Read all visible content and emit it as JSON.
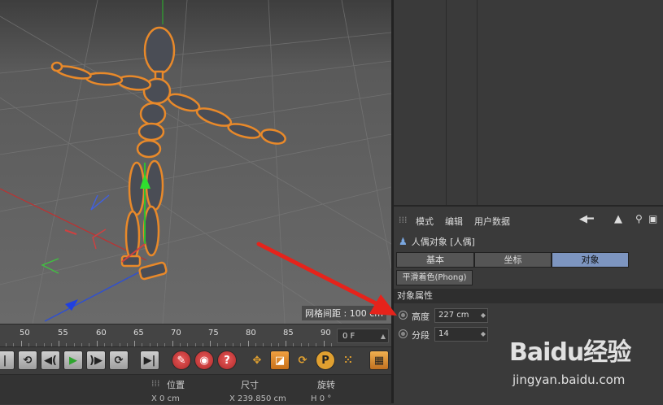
{
  "viewport": {
    "grid_spacing_label": "网格间距 : 100 cm"
  },
  "timeline": {
    "ticks": [
      "50",
      "55",
      "60",
      "65",
      "70",
      "75",
      "80",
      "85",
      "90"
    ],
    "current_frame": "0 F"
  },
  "transport": {
    "buttons": [
      "go-start",
      "prev-key",
      "play-back",
      "play-forward",
      "next-key",
      "go-end",
      "goto-frame",
      "record",
      "autokey",
      "keyframe-help",
      "move-key",
      "scale-key",
      "rotate-key",
      "param-key",
      "point-level",
      "film-strip"
    ]
  },
  "coord_strip": {
    "position_label": "位置",
    "size_label": "尺寸",
    "rotation_label": "旋转",
    "x_pos": "X  0 cm",
    "x_size": "X  239.850 cm",
    "h_rot": "H  0 °"
  },
  "attribute_manager": {
    "menu": [
      "模式",
      "编辑",
      "用户数据"
    ],
    "object_title": "人偶对象 [人偶]",
    "tabs": [
      {
        "label": "基本",
        "active": false
      },
      {
        "label": "坐标",
        "active": false
      },
      {
        "label": "对象",
        "active": true
      }
    ],
    "phong_tab": "平滑着色(Phong)",
    "section": "对象属性",
    "props": [
      {
        "label": "高度",
        "value": "227 cm"
      },
      {
        "label": "分段",
        "value": "14"
      }
    ]
  },
  "colors": {
    "accent_tab": "#7d95c0",
    "selection_outline": "#e8892a",
    "annotation_arrow": "#e5231b"
  },
  "watermark": {
    "logo": "Baidu经验",
    "url": "jingyan.baidu.com"
  }
}
